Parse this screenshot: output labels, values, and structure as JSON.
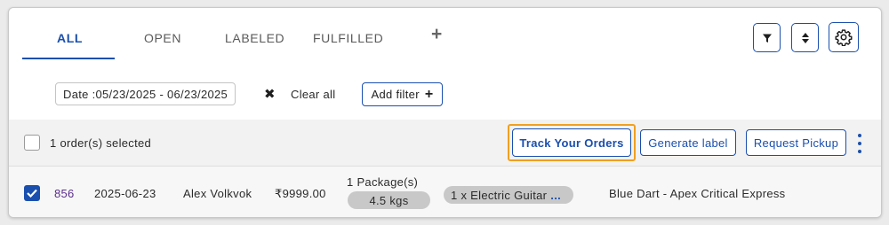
{
  "tabs": [
    {
      "label": "ALL",
      "active": true
    },
    {
      "label": "OPEN",
      "active": false
    },
    {
      "label": "LABELED",
      "active": false
    },
    {
      "label": "FULFILLED",
      "active": false
    }
  ],
  "add_tab_label": "+",
  "toolbar_icons": [
    "filter-icon",
    "sort-icon",
    "gear-icon"
  ],
  "filters": {
    "date_chip": "Date :05/23/2025 - 06/23/2025",
    "clear_x": "✖",
    "clear_all": "Clear all",
    "add_filter": "Add filter",
    "add_filter_plus": "+"
  },
  "selection_bar": {
    "selected_text": "1 order(s) selected",
    "track_button": "Track Your Orders",
    "generate_button": "Generate label",
    "pickup_button": "Request Pickup"
  },
  "order": {
    "id": "856",
    "date": "2025-06-23",
    "customer": "Alex Volkvok",
    "amount": "₹9999.00",
    "packages": "1 Package(s)",
    "weight": "4.5 kgs",
    "item": "1 x Electric Guitar",
    "item_more": "...",
    "courier": "Blue Dart - Apex Critical Express",
    "checked": true
  },
  "colors": {
    "accent": "#1a4fae",
    "highlight": "#f0a020",
    "order_id": "#5b2d8e"
  }
}
